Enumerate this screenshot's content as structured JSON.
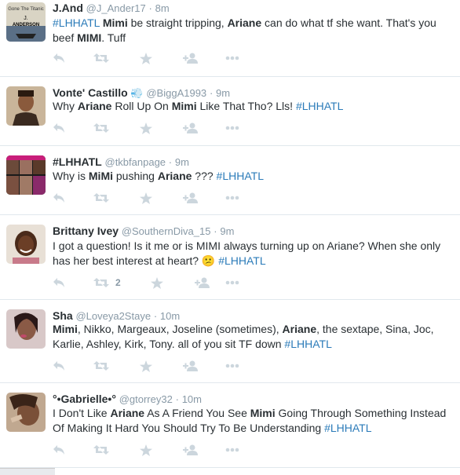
{
  "tweets": [
    {
      "fullname": "J.And",
      "username": "@J_Ander17",
      "time": "8m",
      "avatar_text": [
        "Gone The Titanic",
        "J.",
        "ANDERSON"
      ],
      "body": [
        {
          "t": "#LHHATL",
          "s": "hash"
        },
        {
          "t": " ",
          "s": ""
        },
        {
          "t": "Mimi",
          "s": "b"
        },
        {
          "t": " be straight tripping, ",
          "s": ""
        },
        {
          "t": "Ariane",
          "s": "b"
        },
        {
          "t": " can do what tf she want. That's you beef ",
          "s": ""
        },
        {
          "t": "MIMI",
          "s": "b"
        },
        {
          "t": ". Tuff",
          "s": ""
        }
      ],
      "retweets": ""
    },
    {
      "fullname": "Vonte' Castillo",
      "badge": "💨",
      "username": "@BiggA1993",
      "time": "9m",
      "body": [
        {
          "t": "Why ",
          "s": ""
        },
        {
          "t": "Ariane",
          "s": "b"
        },
        {
          "t": " Roll Up On ",
          "s": ""
        },
        {
          "t": "Mimi",
          "s": "b"
        },
        {
          "t": " Like That Tho? Lls! ",
          "s": ""
        },
        {
          "t": "#LHHATL",
          "s": "hash"
        }
      ],
      "retweets": ""
    },
    {
      "fullname": "#LHHATL",
      "username": "@tkbfanpage",
      "time": "9m",
      "body": [
        {
          "t": "Why is ",
          "s": ""
        },
        {
          "t": "MiMi",
          "s": "b"
        },
        {
          "t": " pushing ",
          "s": ""
        },
        {
          "t": "Ariane",
          "s": "b"
        },
        {
          "t": " ??? ",
          "s": ""
        },
        {
          "t": "#LHHATL",
          "s": "hash"
        }
      ],
      "retweets": ""
    },
    {
      "fullname": "Brittany Ivey",
      "username": "@SouthernDiva_15",
      "time": "9m",
      "body": [
        {
          "t": "I got a question! Is it me or is MIMI always turning up on Ariane? When she only has her best interest at heart? ",
          "s": ""
        },
        {
          "t": "😕",
          "s": ""
        },
        {
          "t": " ",
          "s": ""
        },
        {
          "t": "#LHHATL",
          "s": "hash"
        }
      ],
      "retweets": "2"
    },
    {
      "fullname": "Sha",
      "username": "@Loveya2Staye",
      "time": "10m",
      "body": [
        {
          "t": "Mimi",
          "s": "b"
        },
        {
          "t": ", Nikko, Margeaux, Joseline (sometimes), ",
          "s": ""
        },
        {
          "t": "Ariane",
          "s": "b"
        },
        {
          "t": ", the sextape, Sina, Joc, Karlie, Ashley, Kirk, Tony. all of you sit TF down ",
          "s": ""
        },
        {
          "t": "#LHHATL",
          "s": "hash"
        }
      ],
      "retweets": ""
    },
    {
      "fullname": "°•Gabrielle•°",
      "username": "@gtorrey32",
      "time": "10m",
      "body": [
        {
          "t": "I Don't Like ",
          "s": ""
        },
        {
          "t": "Ariane",
          "s": "b"
        },
        {
          "t": " As A Friend You See ",
          "s": ""
        },
        {
          "t": "Mimi",
          "s": "b"
        },
        {
          "t": " Going Through Something Instead Of Making It Hard You Should Try To Be Understanding ",
          "s": ""
        },
        {
          "t": "#LHHATL",
          "s": "hash"
        }
      ],
      "retweets": ""
    }
  ],
  "colors": {
    "link": "#2b7bb9",
    "muted": "#8899a6",
    "icon": "#ccd6dd",
    "text": "#292f33"
  },
  "icons": [
    "reply-icon",
    "retweet-icon",
    "favorite-icon",
    "follow-icon",
    "more-icon"
  ],
  "separator": "·"
}
